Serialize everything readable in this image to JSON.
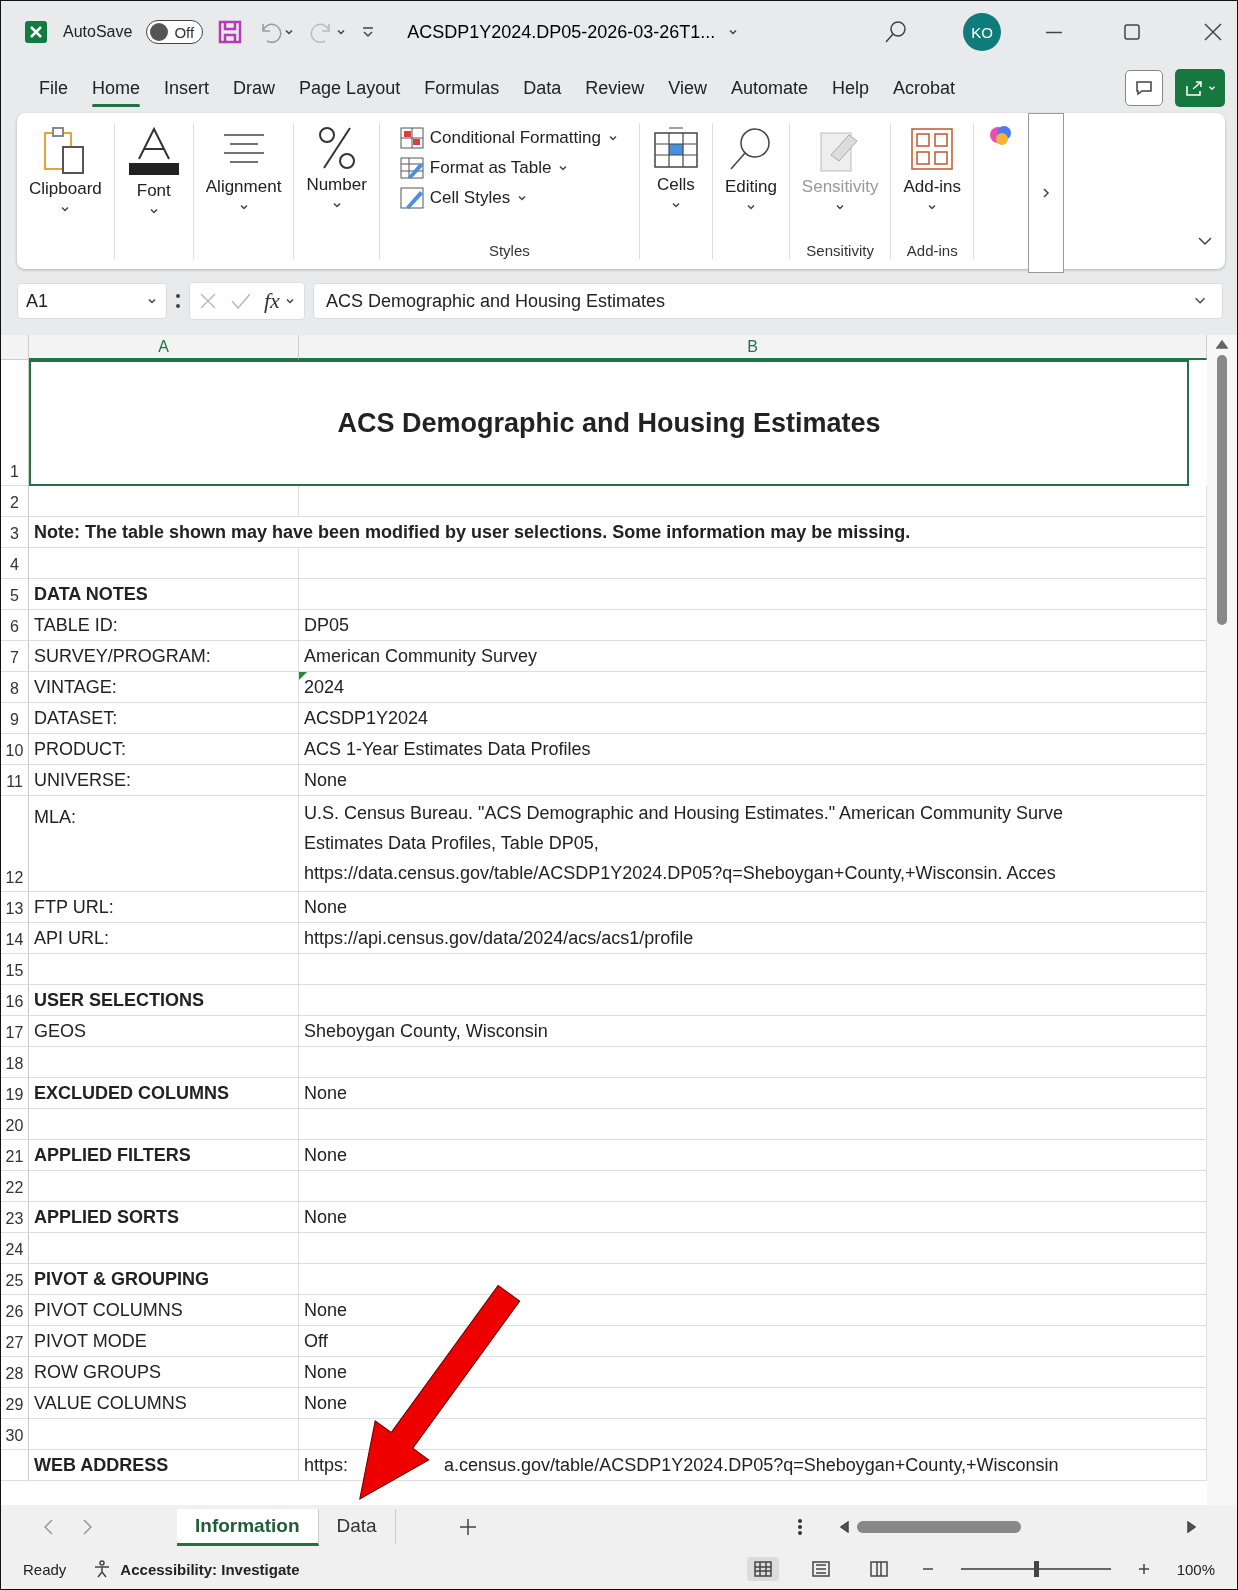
{
  "title_bar": {
    "app_label": "AutoSave",
    "autosave": {
      "label": "Off",
      "on": false
    },
    "filename": "ACSDP1Y2024.DP05-2026-03-26T1...",
    "avatar": "KO"
  },
  "menu_tabs": [
    {
      "label": "File",
      "selected": false
    },
    {
      "label": "Home",
      "selected": true
    },
    {
      "label": "Insert",
      "selected": false
    },
    {
      "label": "Draw",
      "selected": false
    },
    {
      "label": "Page Layout",
      "selected": false
    },
    {
      "label": "Formulas",
      "selected": false
    },
    {
      "label": "Data",
      "selected": false
    },
    {
      "label": "Review",
      "selected": false
    },
    {
      "label": "View",
      "selected": false
    },
    {
      "label": "Automate",
      "selected": false
    },
    {
      "label": "Help",
      "selected": false
    },
    {
      "label": "Acrobat",
      "selected": false
    }
  ],
  "ribbon": {
    "groups": [
      {
        "kind": "big",
        "label": "Clipboard",
        "disabled": false
      },
      {
        "kind": "big",
        "label": "Font",
        "disabled": false
      },
      {
        "kind": "big",
        "label": "Alignment",
        "disabled": false
      },
      {
        "kind": "big",
        "label": "Number",
        "disabled": false
      },
      {
        "kind": "list",
        "items": [
          "Conditional Formatting",
          "Format as Table",
          "Cell Styles"
        ],
        "group_label": "Styles"
      },
      {
        "kind": "big",
        "label": "Cells",
        "disabled": false
      },
      {
        "kind": "big",
        "label": "Editing",
        "disabled": false
      },
      {
        "kind": "big",
        "label": "Sensitivity",
        "disabled": true,
        "group_label": "Sensitivity"
      },
      {
        "kind": "big",
        "label": "Add-ins",
        "disabled": false,
        "group_label": "Add-ins"
      }
    ]
  },
  "formula_bar": {
    "name_box": "A1",
    "function_label": "fx",
    "formula": "ACS Demographic and Housing Estimates"
  },
  "columns": [
    "A",
    "B"
  ],
  "rows": [
    {
      "number": "1",
      "kind": "title",
      "text": "ACS Demographic and Housing Estimates",
      "selected": true
    },
    {
      "number": "2",
      "kind": "blank",
      "selected": false
    },
    {
      "number": "3",
      "kind": "note",
      "text": "Note: The table shown may have been modified by user selections. Some information may be missing.",
      "selected": false
    },
    {
      "number": "4",
      "kind": "blank",
      "selected": false
    },
    {
      "number": "5",
      "kind": "heading",
      "a": "DATA NOTES",
      "selected": false
    },
    {
      "number": "6",
      "kind": "field",
      "a": "TABLE ID:",
      "b": "DP05",
      "flagged": false,
      "selected": false
    },
    {
      "number": "7",
      "kind": "field",
      "a": "SURVEY/PROGRAM:",
      "b": "American Community Survey",
      "flagged": false,
      "selected": false
    },
    {
      "number": "8",
      "kind": "field",
      "a": "VINTAGE:",
      "b": "2024",
      "flagged": true,
      "selected": false
    },
    {
      "number": "9",
      "kind": "field",
      "a": "DATASET:",
      "b": "ACSDP1Y2024",
      "flagged": false,
      "selected": false
    },
    {
      "number": "10",
      "kind": "field",
      "a": "PRODUCT:",
      "b": "ACS 1-Year Estimates Data Profiles",
      "flagged": false,
      "selected": false
    },
    {
      "number": "11",
      "kind": "field",
      "a": "UNIVERSE:",
      "b": "None",
      "flagged": false,
      "selected": false
    },
    {
      "number": "12",
      "kind": "multiline",
      "a": "MLA:",
      "lines": [
        "U.S. Census Bureau. \"ACS Demographic and Housing Estimates.\" American Community Surve",
        "Estimates Data Profiles, Table DP05,",
        "https://data.census.gov/table/ACSDP1Y2024.DP05?q=Sheboygan+County,+Wisconsin. Acces"
      ],
      "selected": false
    },
    {
      "number": "13",
      "kind": "field",
      "a": "FTP URL:",
      "b": "None",
      "flagged": false,
      "selected": false
    },
    {
      "number": "14",
      "kind": "field",
      "a": "API URL:",
      "b": "https://api.census.gov/data/2024/acs/acs1/profile",
      "flagged": false,
      "selected": false
    },
    {
      "number": "15",
      "kind": "blank",
      "selected": false
    },
    {
      "number": "16",
      "kind": "heading",
      "a": "USER SELECTIONS",
      "selected": false
    },
    {
      "number": "17",
      "kind": "field",
      "a": "GEOS",
      "b": "Sheboygan County, Wisconsin",
      "flagged": false,
      "selected": false
    },
    {
      "number": "18",
      "kind": "blank",
      "selected": false
    },
    {
      "number": "19",
      "kind": "heading",
      "a": "EXCLUDED COLUMNS",
      "b": "None",
      "selected": false
    },
    {
      "number": "20",
      "kind": "blank",
      "selected": false
    },
    {
      "number": "21",
      "kind": "heading",
      "a": "APPLIED FILTERS",
      "b": "None",
      "selected": false
    },
    {
      "number": "22",
      "kind": "blank",
      "selected": false
    },
    {
      "number": "23",
      "kind": "heading",
      "a": "APPLIED SORTS",
      "b": "None",
      "selected": false
    },
    {
      "number": "24",
      "kind": "blank",
      "selected": false
    },
    {
      "number": "25",
      "kind": "heading",
      "a": "PIVOT & GROUPING",
      "selected": false
    },
    {
      "number": "26",
      "kind": "field",
      "a": "PIVOT COLUMNS",
      "b": "None",
      "flagged": false,
      "selected": false
    },
    {
      "number": "27",
      "kind": "field",
      "a": "PIVOT MODE",
      "b": "Off",
      "flagged": false,
      "selected": false
    },
    {
      "number": "28",
      "kind": "field",
      "a": "ROW GROUPS",
      "b": "None",
      "flagged": false,
      "selected": false
    },
    {
      "number": "29",
      "kind": "field",
      "a": "VALUE COLUMNS",
      "b": "None",
      "flagged": false,
      "selected": false
    },
    {
      "number": "30",
      "kind": "blank",
      "selected": false
    },
    {
      "kind": "split",
      "a": "WEB ADDRESS",
      "parts": [
        "https:",
        "a.census.gov/table/ACSDP1Y2024.DP05?q=Sheboygan+County,+Wisconsin"
      ],
      "selected": false
    }
  ],
  "sheet_tabs": [
    {
      "label": "Information",
      "selected": true
    },
    {
      "label": "Data",
      "selected": false
    }
  ],
  "status_bar": {
    "mode": "Ready",
    "accessibility": "Accessibility: Investigate",
    "views": [
      {
        "selected": true
      },
      {
        "selected": false
      },
      {
        "selected": false
      }
    ],
    "zoom_level": {
      "level": 0.5
    },
    "zoom": "100%"
  }
}
